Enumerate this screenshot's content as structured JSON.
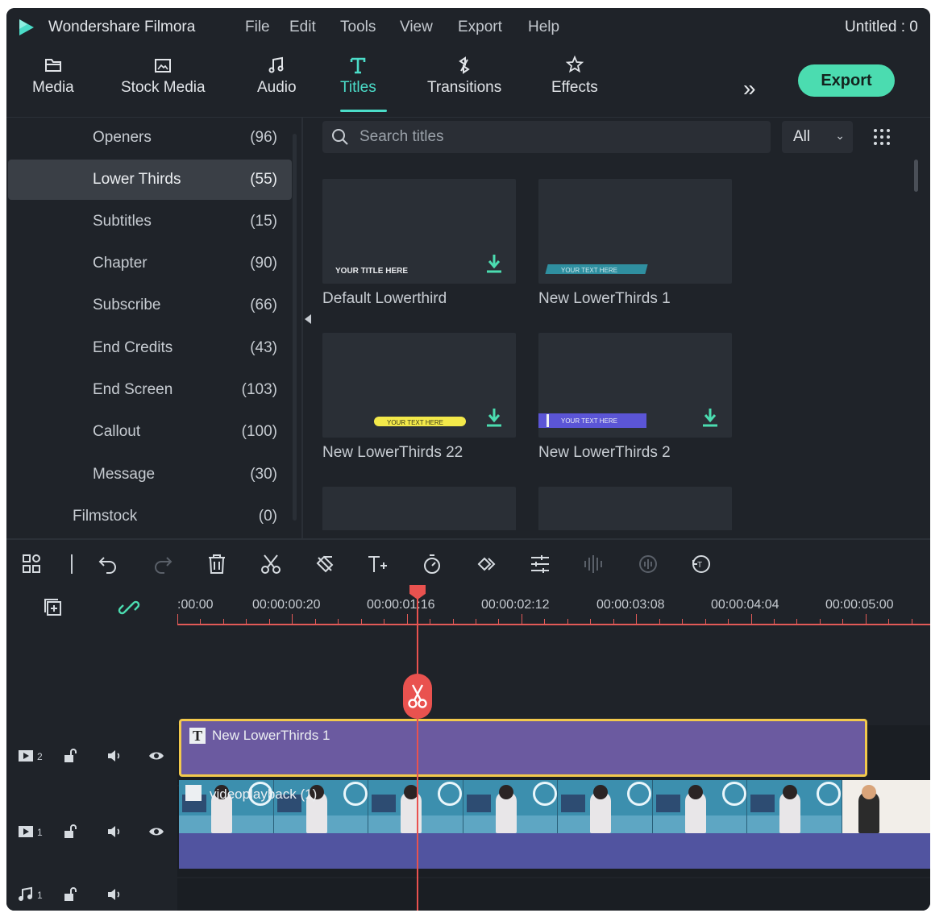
{
  "app": {
    "name": "Wondershare Filmora",
    "document_title": "Untitled : 0"
  },
  "menu": [
    "File",
    "Edit",
    "Tools",
    "View",
    "Export",
    "Help"
  ],
  "toolbar": {
    "tabs": [
      {
        "label": "Media",
        "icon": "folder-icon",
        "active": false
      },
      {
        "label": "Stock Media",
        "icon": "stock-media-icon",
        "active": false
      },
      {
        "label": "Audio",
        "icon": "music-note-icon",
        "active": false
      },
      {
        "label": "Titles",
        "icon": "title-t-icon",
        "active": true
      },
      {
        "label": "Transitions",
        "icon": "transitions-icon",
        "active": false
      },
      {
        "label": "Effects",
        "icon": "effects-icon",
        "active": false
      }
    ],
    "more_icon": "double-chevron-right-icon",
    "export_label": "Export"
  },
  "categories": [
    {
      "name": "Openers",
      "count": "(96)",
      "active": false
    },
    {
      "name": "Lower Thirds",
      "count": "(55)",
      "active": true
    },
    {
      "name": "Subtitles",
      "count": "(15)",
      "active": false
    },
    {
      "name": "Chapter",
      "count": "(90)",
      "active": false
    },
    {
      "name": "Subscribe",
      "count": "(66)",
      "active": false
    },
    {
      "name": "End Credits",
      "count": "(43)",
      "active": false
    },
    {
      "name": "End Screen",
      "count": "(103)",
      "active": false
    },
    {
      "name": "Callout",
      "count": "(100)",
      "active": false
    },
    {
      "name": "Message",
      "count": "(30)",
      "active": false
    },
    {
      "name": "Filmstock",
      "count": "(0)",
      "active": false
    }
  ],
  "titles_panel": {
    "search_placeholder": "Search titles",
    "filter_value": "All",
    "cards": [
      {
        "label": "Default Lowerthird",
        "preview_text": "YOUR TITLE HERE",
        "downloadable": true
      },
      {
        "label": "New LowerThirds 1",
        "preview_text": "YOUR TEXT HERE",
        "downloadable": false
      },
      {
        "label": "New LowerThirds 22",
        "preview_text": "YOUR TEXT HERE",
        "downloadable": true
      },
      {
        "label": "New LowerThirds 2",
        "preview_text": "YOUR TEXT HERE",
        "downloadable": true
      }
    ]
  },
  "timeline": {
    "ruler_labels": [
      ":00:00",
      "00:00:00:20",
      "00:00:01:16",
      "00:00:02:12",
      "00:00:03:08",
      "00:00:04:04",
      "00:00:05:00"
    ],
    "tracks": [
      {
        "type": "video",
        "number": "2",
        "clip_label": "New LowerThirds 1"
      },
      {
        "type": "video",
        "number": "1",
        "clip_label": "videoplayback (1)"
      },
      {
        "type": "audio",
        "number": "1"
      }
    ]
  },
  "colors": {
    "accent": "#4bdcc8",
    "export_button": "#4bdcb0",
    "playhead": "#e9524f",
    "title_clip": "#6b5aa0",
    "title_clip_border": "#f2c94c",
    "video_clip": "#5154a0"
  }
}
